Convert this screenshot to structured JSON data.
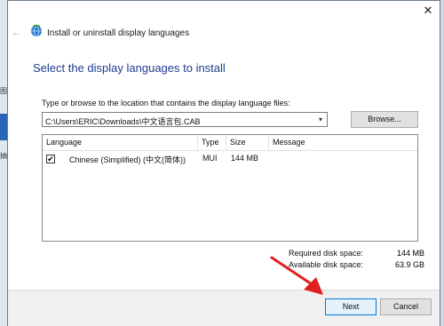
{
  "window": {
    "title": "Install or uninstall display languages",
    "close_glyph": "✕",
    "back_glyph": "←"
  },
  "heading": "Select the display languages to install",
  "path": {
    "label": "Type or browse to the location that contains the display language files:",
    "value": "C:\\Users\\ERIC\\Downloads\\中文语言包.CAB",
    "dropdown_glyph": "▾"
  },
  "buttons": {
    "browse": "Browse...",
    "next": "Next",
    "cancel": "Cancel"
  },
  "table": {
    "headers": [
      "Language",
      "Type",
      "Size",
      "Message"
    ],
    "rows": [
      {
        "checked": "✔",
        "language": "Chinese (Simplified) (中文(简体))",
        "type": "MUI",
        "size": "144 MB",
        "message": ""
      }
    ]
  },
  "disk": {
    "required_label": "Required disk space:",
    "required_value": "144 MB",
    "available_label": "Available disk space:",
    "available_value": "63.9 GB"
  },
  "background_marks": [
    "图",
    "抽"
  ],
  "colors": {
    "heading": "#1d3c8f",
    "arrow": "#e0201e",
    "next_border": "#0078d7"
  },
  "icons": [
    "globe-icon",
    "back-arrow-icon",
    "close-icon",
    "chevron-down-icon",
    "checkbox-icon",
    "red-arrow-annotation"
  ]
}
